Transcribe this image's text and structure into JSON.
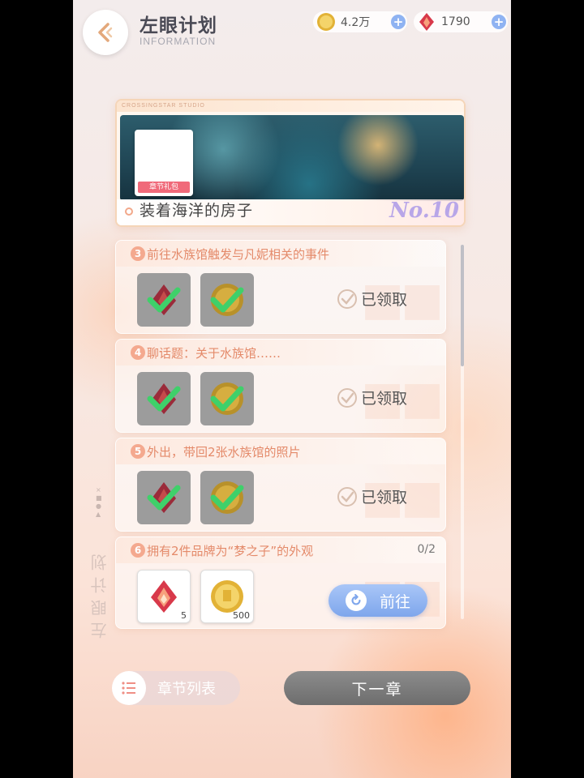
{
  "header": {
    "title": "左眼计划",
    "subtitle": "INFORMATION",
    "gold": "4.2万",
    "gems": "1790"
  },
  "banner": {
    "studio": "CROSSINGSTAR STUDIO",
    "thumb_label": "章节礼包",
    "title": "装着海洋的房子",
    "number": "No.10"
  },
  "tasks": [
    {
      "num": "3",
      "title": "前往水族馆触发与凡妮相关的事件",
      "status": "已领取",
      "claimed": true
    },
    {
      "num": "4",
      "title": "聊话题：关于水族馆……",
      "status": "已领取",
      "claimed": true
    },
    {
      "num": "5",
      "title": "外出，带回2张水族馆的照片",
      "status": "已领取",
      "claimed": true
    },
    {
      "num": "6",
      "title": "拥有2件品牌为“梦之子”的外观",
      "progress": "0/2",
      "gem_qty": "5",
      "gold_qty": "500",
      "action": "前往",
      "claimed": false
    }
  ],
  "side_title": "左眼计划",
  "footer": {
    "chapter_list": "章节列表",
    "next_chapter": "下一章"
  },
  "colors": {
    "accent": "#e48a6a",
    "go_button": "#7ea6ec",
    "claimed_check": "#3fd06a"
  }
}
